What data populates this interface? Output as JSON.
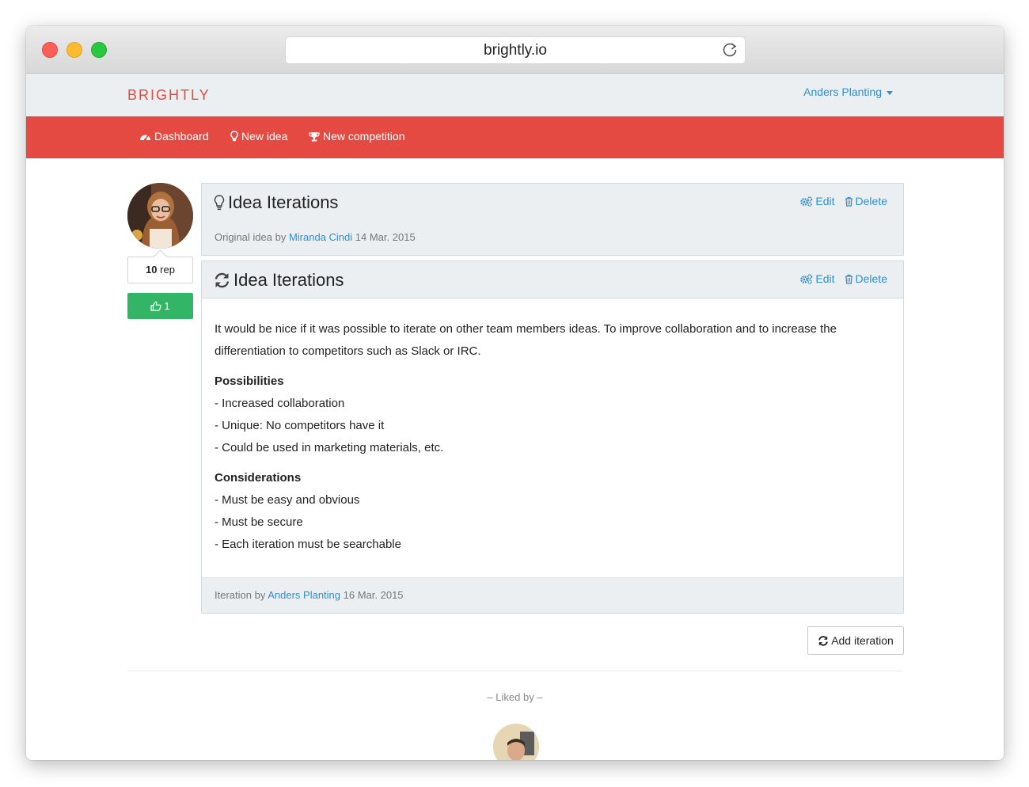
{
  "browser": {
    "url": "brightly.io"
  },
  "navbar": {
    "brand": "BRIGHTLY",
    "user_name": "Anders Planting"
  },
  "menu": {
    "dashboard": "Dashboard",
    "new_idea": "New idea",
    "new_competition": "New competition"
  },
  "author": {
    "rep_value": "10",
    "rep_label": "rep",
    "likes": "1"
  },
  "original": {
    "title": "Idea Iterations",
    "edit": "Edit",
    "delete": "Delete",
    "by_label": "Original idea by",
    "author": "Miranda Cindi",
    "date": "14 Mar. 2015"
  },
  "iteration": {
    "title": "Idea Iterations",
    "edit": "Edit",
    "delete": "Delete",
    "intro": "It would be nice if it was possible to iterate on other team members ideas. To improve collaboration and to increase the differentiation to competitors such as Slack or IRC.",
    "possibilities_heading": "Possibilities",
    "possibilities": [
      "- Increased collaboration",
      "- Unique: No competitors have it",
      "- Could be used in marketing materials, etc."
    ],
    "considerations_heading": "Considerations",
    "considerations": [
      "- Must be easy and obvious",
      "- Must be secure",
      "- Each iteration must be searchable"
    ],
    "by_label": "Iteration by",
    "author": "Anders Planting",
    "date": "16 Mar. 2015"
  },
  "add_iteration_label": "Add iteration",
  "liked_by_label": "– Liked by –",
  "colors": {
    "brand_red": "#e54a42",
    "link_blue": "#2f8fd0",
    "like_green": "#32b666",
    "panel_gray": "#ebeff1"
  },
  "icons": {
    "dashboard": "dashboard-icon",
    "new_idea": "lightbulb-icon",
    "new_competition": "trophy-icon",
    "edit": "gears-icon",
    "delete": "trash-icon",
    "iteration": "refresh-icon",
    "like": "thumbs-up-icon"
  }
}
